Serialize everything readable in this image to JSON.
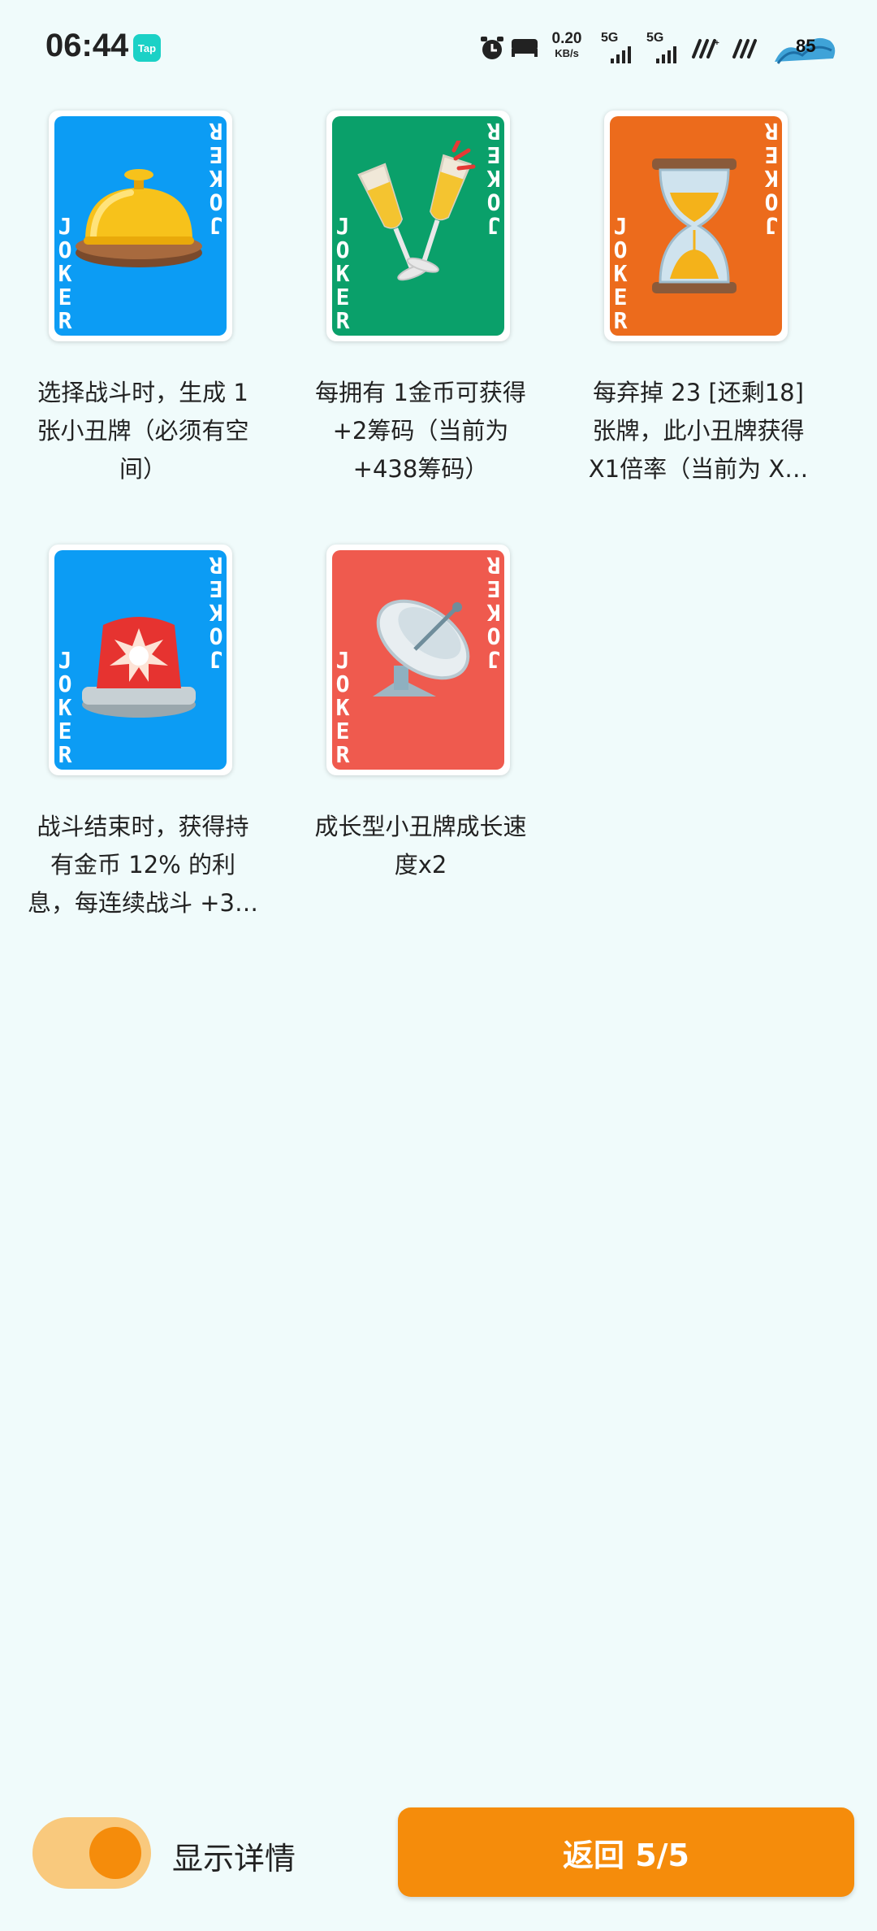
{
  "status_bar": {
    "time": "06:44",
    "app_badge": "Tap",
    "net_speed_value": "0.20",
    "net_speed_unit": "KB/s",
    "sim1": "5G",
    "sim2": "5G",
    "battery": "85"
  },
  "cards": [
    {
      "joker": "JOKER",
      "bg": "#0c9cf4",
      "icon": "service-bell",
      "description": "选择战斗时，生成 1 张小丑牌（必须有空间）"
    },
    {
      "joker": "JOKER",
      "bg": "#0aa06a",
      "icon": "champagne-glasses",
      "description": "每拥有 1金币可获得 +2筹码（当前为 +438筹码）"
    },
    {
      "joker": "JOKER",
      "bg": "#ec6b1c",
      "icon": "hourglass",
      "description": "每弃掉 23 [还剩18] 张牌，此小丑牌获得 X1倍率（当前为 X…"
    },
    {
      "joker": "JOKER",
      "bg": "#0c9cf4",
      "icon": "police-siren",
      "description": "战斗结束时，获得持有金币 12% 的利息，每连续战斗 +3…"
    },
    {
      "joker": "JOKER",
      "bg": "#ef5a4e",
      "icon": "satellite-dish",
      "description": "成长型小丑牌成长速度x2"
    }
  ],
  "bottom": {
    "toggle_label": "显示详情",
    "toggle_on": true,
    "back_label": "返回 5/5"
  },
  "colors": {
    "accent": "#f58c0b",
    "background": "#f0fbfb"
  }
}
